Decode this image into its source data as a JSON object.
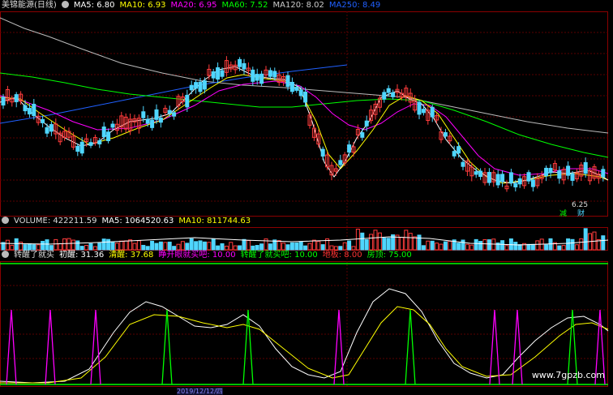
{
  "main": {
    "title": "美锦能源(日线)",
    "ma5": "MA5: 6.80",
    "ma10": "MA10: 6.93",
    "ma20": "MA20: 6.95",
    "ma60": "MA60: 7.52",
    "ma120": "MA120: 8.02",
    "ma250": "MA250: 8.49",
    "low_price": "6.25",
    "tag_jian": "减",
    "tag_cai": "财"
  },
  "volume": {
    "label": "VOLUME: 422211.59",
    "ma5": "MA5: 1064520.63",
    "ma10": "MA10: 811744.63"
  },
  "indicator": {
    "name": "转醒了就买",
    "chuxing": "初醒: 31.36",
    "qingxing": "清醒: 37.68",
    "zhengkai": "睁开眼就买吧: 10.00",
    "zhuanxing": "转醒了就买吧: 10.00",
    "dijin": "地板: 8.00",
    "fangding": "房顶: 75.00"
  },
  "date_label": "2019/12/12/四",
  "watermark": "www.7gpzb.com",
  "colors": {
    "up": "#ff3c3c",
    "down": "#4fd6ff",
    "ma5": "#ffffff",
    "ma10": "#ffff00",
    "ma20": "#ff00ff",
    "ma60": "#00ff00",
    "ma120": "#bbbbbb",
    "ma250": "#2060ff"
  }
}
